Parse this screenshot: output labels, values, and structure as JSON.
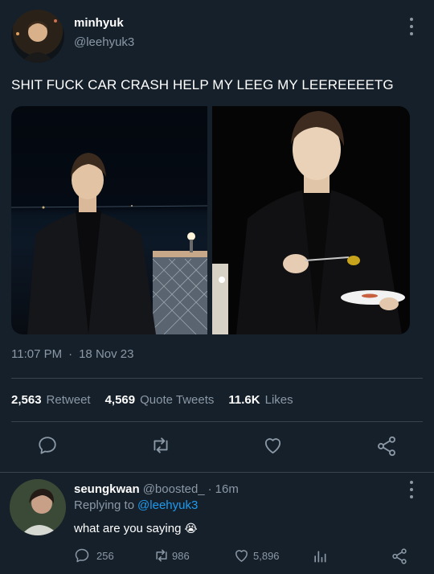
{
  "tweet": {
    "display_name": "minhyuk",
    "handle": "@leehyuk3",
    "text": "SHIT FUCK CAR CRASH HELP MY LEEG MY LEEREEEETG",
    "time": "11:07 PM",
    "dot": "·",
    "date": "18 Nov 23",
    "stats": {
      "retweets_count": "2,563",
      "retweets_label": "Retweet",
      "quotes_count": "4,569",
      "quotes_label": "Quote Tweets",
      "likes_count": "11.6K",
      "likes_label": "Likes"
    },
    "actions": [
      "reply-icon",
      "retweet-icon",
      "like-icon",
      "share-icon"
    ]
  },
  "reply": {
    "display_name": "seungkwan",
    "handle": "@boosted_",
    "separator": "·",
    "age": "16m",
    "replying_to_prefix": "Replying to",
    "replying_to_handle": "@leehyuk3",
    "text": "what are you saying",
    "emoji": "😭",
    "actions": {
      "reply_count": "256",
      "retweet_count": "986",
      "like_count": "5,896"
    }
  },
  "colors": {
    "background": "#15202b",
    "muted": "#8b98a5",
    "link": "#1d9bf0",
    "divider": "#38444d"
  }
}
